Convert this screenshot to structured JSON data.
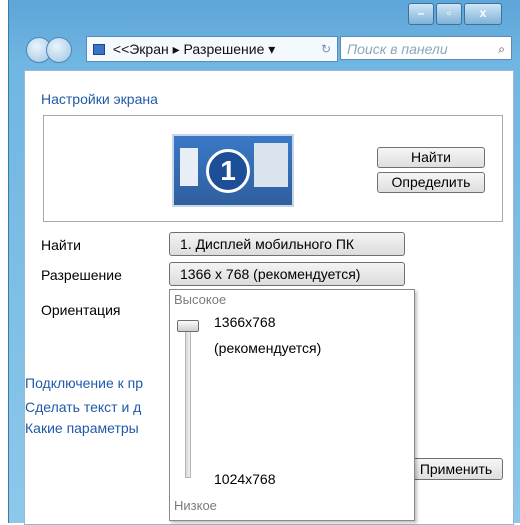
{
  "window": {
    "minimize_glyph": "–",
    "maximize_glyph": "▫",
    "close_glyph": "x"
  },
  "address_bar": {
    "path": "<<Экран ▸ Разрешение ▾",
    "refresh_icon": "refresh-icon"
  },
  "search": {
    "placeholder": "Поиск в панели",
    "icon": "search-icon"
  },
  "page": {
    "title": "Настройки экрана",
    "monitor_number": "1",
    "find_button": "Найти",
    "identify_button": "Определить"
  },
  "settings": {
    "display_label": "Найти",
    "display_value": "1. Дисплей мобильного ПК",
    "resolution_label": "Разрешение",
    "resolution_value": "1366 x 768 (рекомендуется)",
    "orientation_label": "Ориентация"
  },
  "links": {
    "connect": "Подключение к пр",
    "text_size": "Сделать текст и д",
    "which_params": "Какие параметры"
  },
  "apply_button": "Применить",
  "resolution_popup": {
    "high_label": "Высокое",
    "low_label": "Низкое",
    "top_option_line1": "1366x768",
    "top_option_line2": "(рекомендуется)",
    "bottom_option": "1024x768",
    "slider_level": 1.0
  },
  "colors": {
    "link": "#1f5aa8",
    "frame": "#6fb6e2",
    "monitor": "#2f5f9e"
  }
}
